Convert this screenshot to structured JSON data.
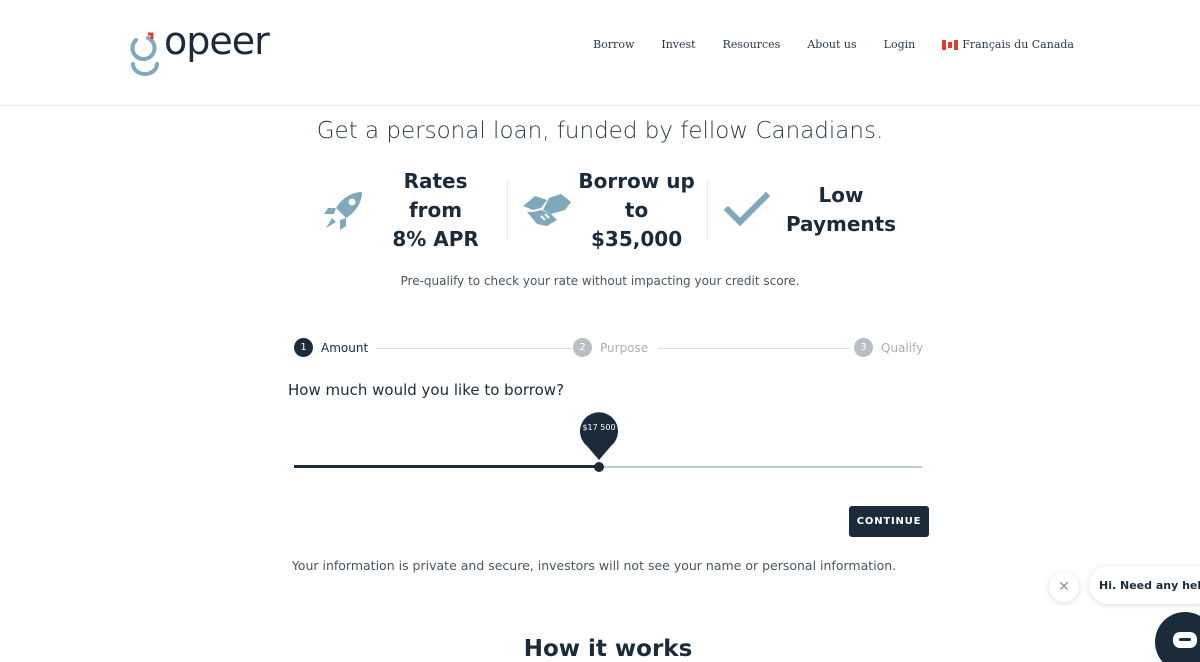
{
  "header": {
    "logo_text": "gopeer",
    "nav": [
      "Borrow",
      "Invest",
      "Resources",
      "About us",
      "Login"
    ],
    "language": "Français du Canada"
  },
  "hero": {
    "headline": "Get a personal loan, funded by fellow Canadians.",
    "features": [
      {
        "icon": "rocket-icon",
        "line1": "Rates from",
        "line2": "8% APR"
      },
      {
        "icon": "handshake-icon",
        "line1": "Borrow up",
        "line2": "to $35,000"
      },
      {
        "icon": "checkmark-icon",
        "line1": "Low",
        "line2": "Payments"
      }
    ],
    "subtext": "Pre-qualify to check your rate without impacting your credit score."
  },
  "steps": [
    {
      "num": "1",
      "label": "Amount"
    },
    {
      "num": "2",
      "label": "Purpose"
    },
    {
      "num": "3",
      "label": "Qualify"
    }
  ],
  "form": {
    "question": "How much would you like to borrow?",
    "slider_value_label": "$17 500",
    "slider_fraction": 0.485,
    "continue_label": "CONTINUE"
  },
  "privacy": "Your information is private and secure, investors will not see your name or personal information.",
  "section_title": "How it works",
  "chat": {
    "close_glyph": "✕",
    "message": "Hi. Need any help?"
  },
  "colors": {
    "brand_dark": "#1c2b3a",
    "accent_teal": "#7fa9ba",
    "accent_red": "#e03c31"
  }
}
